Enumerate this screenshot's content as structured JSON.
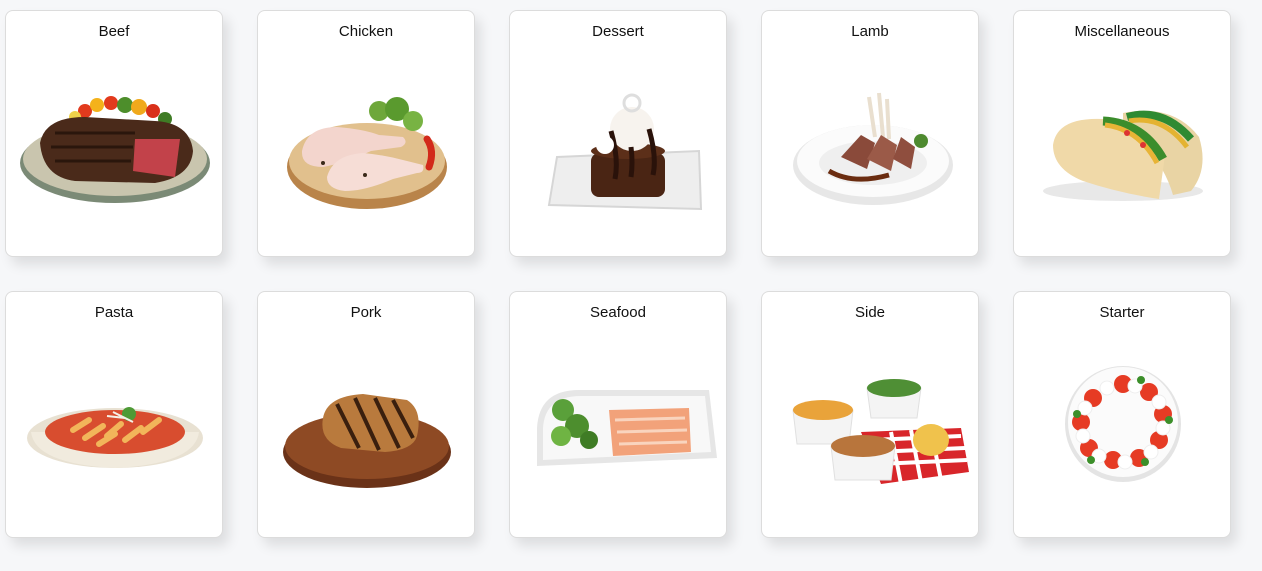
{
  "categories": [
    {
      "label": "Beef",
      "image": "beef-steak-plate"
    },
    {
      "label": "Chicken",
      "image": "raw-chicken-legs-board"
    },
    {
      "label": "Dessert",
      "image": "chocolate-brownie-sundae"
    },
    {
      "label": "Lamb",
      "image": "lamb-chops-plate"
    },
    {
      "label": "Miscellaneous",
      "image": "tacos"
    },
    {
      "label": "Pasta",
      "image": "penne-pasta-bowl"
    },
    {
      "label": "Pork",
      "image": "grilled-pork-chop-board"
    },
    {
      "label": "Seafood",
      "image": "salmon-carpaccio-platter"
    },
    {
      "label": "Side",
      "image": "side-dishes-ramekins"
    },
    {
      "label": "Starter",
      "image": "caprese-salad-wreath"
    }
  ]
}
